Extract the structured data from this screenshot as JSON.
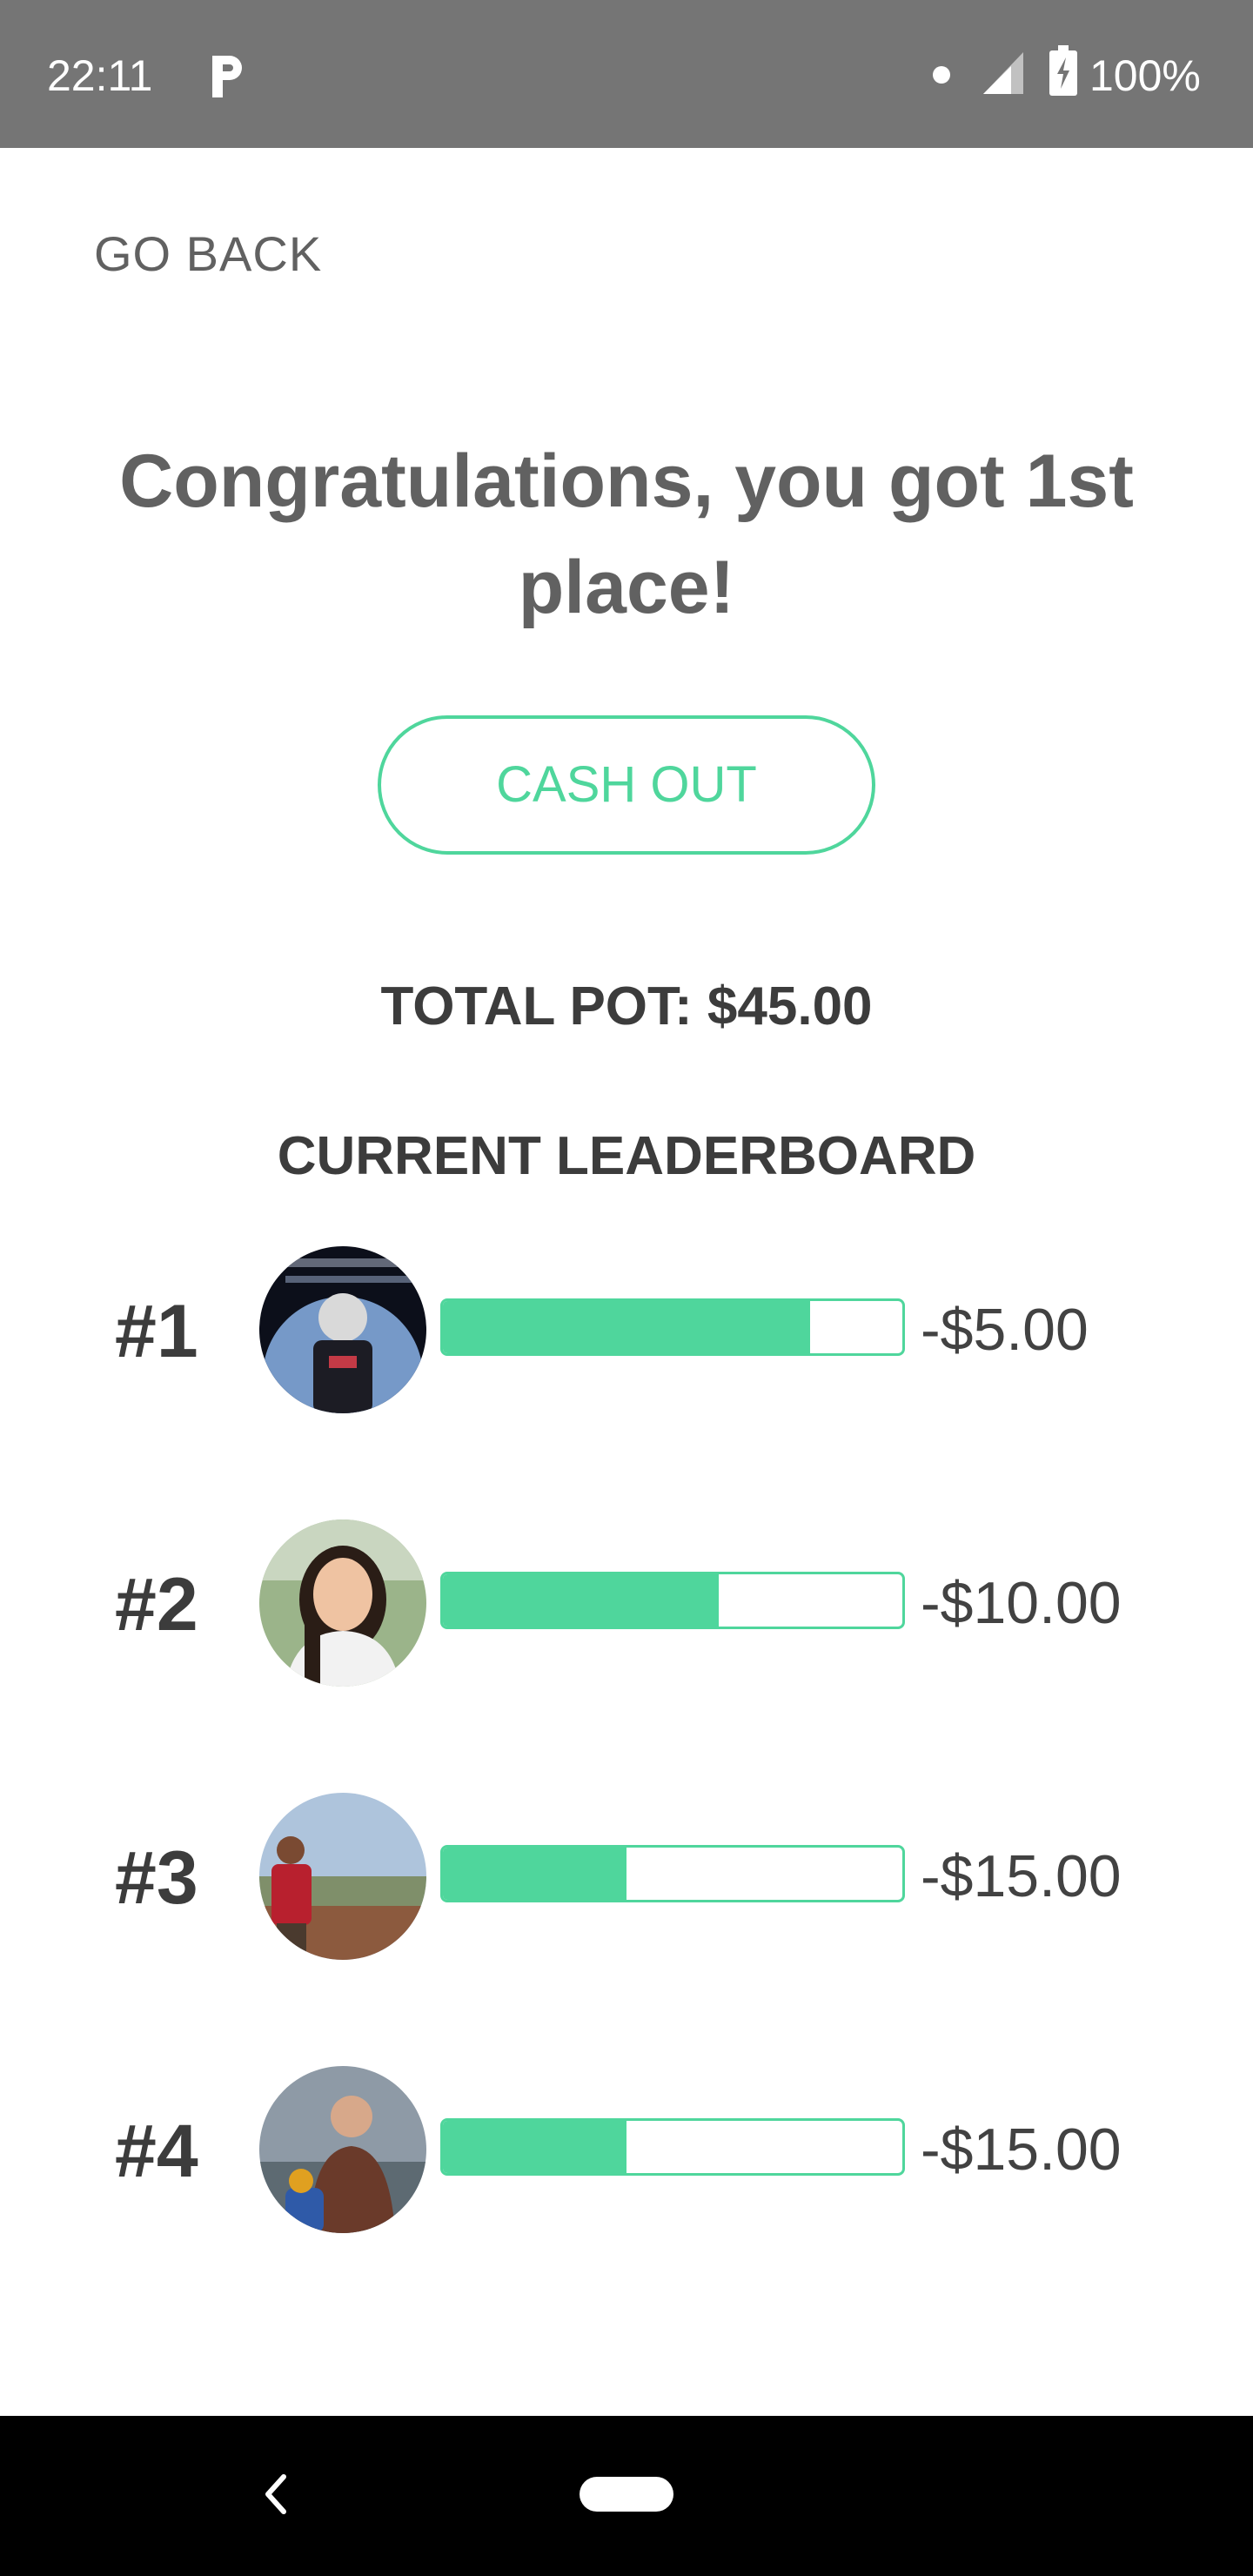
{
  "status_bar": {
    "time": "22:11",
    "battery_percent": "100%",
    "app_icon": "p-letter-icon",
    "background_color": "#757575"
  },
  "nav": {
    "go_back_label": "GO BACK"
  },
  "result": {
    "headline": "Congratulations, you got 1st place!",
    "cash_out_label": "CASH OUT",
    "total_pot_text": "TOTAL POT: $45.00"
  },
  "leaderboard": {
    "title": "CURRENT LEADERBOARD",
    "accent_color": "#4fd69c",
    "entries": [
      {
        "rank": "#1",
        "amount": "-$5.00",
        "progress": 0.8
      },
      {
        "rank": "#2",
        "amount": "-$10.00",
        "progress": 0.6
      },
      {
        "rank": "#3",
        "amount": "-$15.00",
        "progress": 0.4
      },
      {
        "rank": "#4",
        "amount": "-$15.00",
        "progress": 0.4
      }
    ]
  },
  "system_nav": {
    "back_icon": "chevron-left-icon",
    "home_icon": "home-pill-icon"
  }
}
